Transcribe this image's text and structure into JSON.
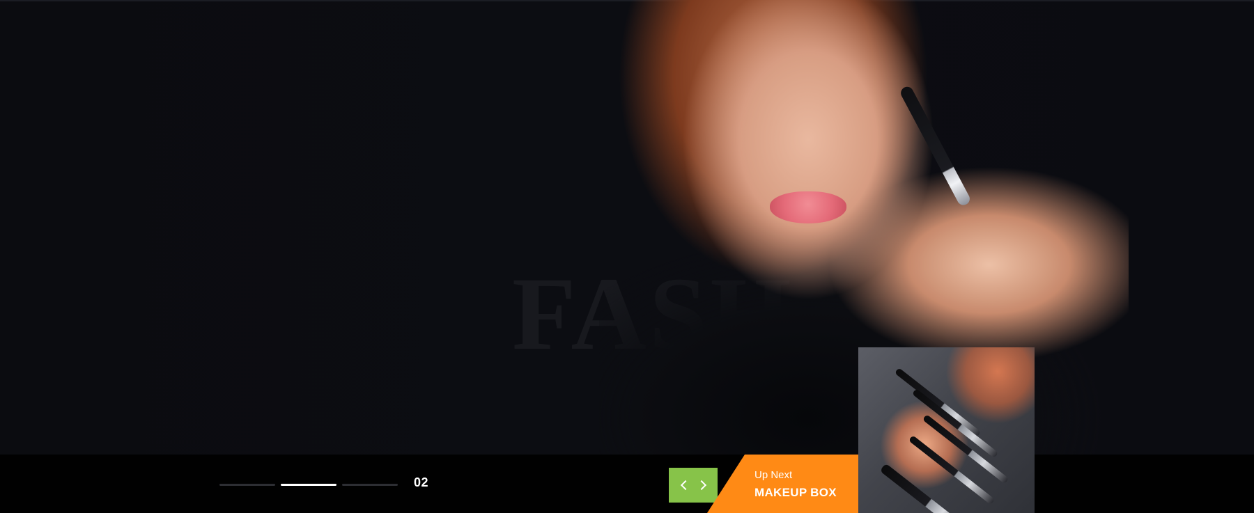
{
  "hero": {
    "background_word": "FASH"
  },
  "pager": {
    "current_index": "02",
    "segments": 3,
    "active_segment": 2
  },
  "up_next": {
    "label": "Up Next",
    "title": "MAKEUP BOX"
  },
  "colors": {
    "nav_green": "#87c349",
    "up_next_orange": "#ff8a15",
    "bottom_bar": "#010101",
    "hero_bg": "#0c0d11"
  },
  "icons": {
    "prev": "chevron-left-icon",
    "next": "chevron-right-icon"
  }
}
